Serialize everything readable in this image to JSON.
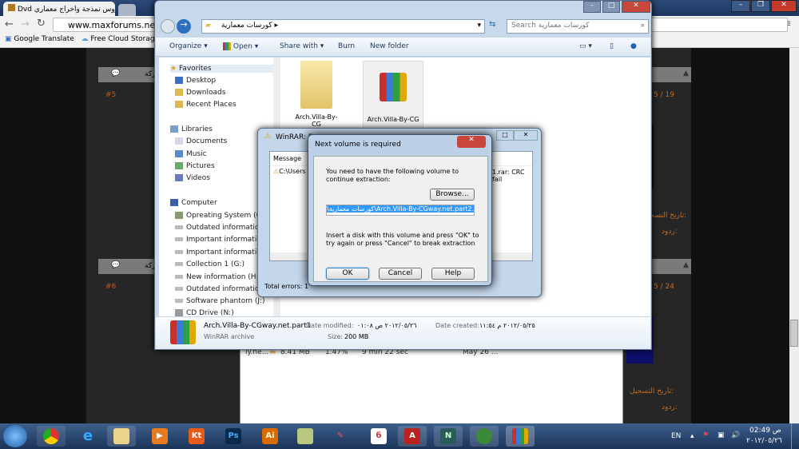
{
  "browser": {
    "tab_title": "Dvd روس نمذجة واخراج معماري",
    "url": "www.maxforums.net/s",
    "bookmarks": [
      "Google Translate",
      "Free Cloud Storage -"
    ]
  },
  "forum": {
    "posts": [
      {
        "num": "#5",
        "date": "5 / 19",
        "label1": "تاريخ التسجيل:",
        "label2": "ردود:",
        "action": "مشاركة"
      },
      {
        "num": "#6",
        "date": "5 / 24",
        "label1": "تاريخ التسجيل:",
        "label2": "ردود:",
        "action": "مشاركة"
      }
    ]
  },
  "explorer": {
    "breadcrumb": "كورسات معمارية",
    "search_placeholder": "Search كورسات معمارية",
    "toolbar": {
      "organize": "Organize",
      "open": "Open",
      "share": "Share with",
      "burn": "Burn",
      "new_folder": "New folder"
    },
    "nav": {
      "favorites": "Favorites",
      "fav_items": [
        "Desktop",
        "Downloads",
        "Recent Places"
      ],
      "libraries": "Libraries",
      "lib_items": [
        "Documents",
        "Music",
        "Pictures",
        "Videos"
      ],
      "computer": "Computer",
      "drives": [
        "Opreating System (C:)",
        "Outdated information",
        "Important information",
        "Important information",
        "Collection 1 (G:)",
        "New information (H:)",
        "Outdated information",
        "Software phantom  (J:)",
        "CD Drive (N:)"
      ]
    },
    "files": [
      "Arch.Villa-By-CG",
      "Arch.Villa-By-CG"
    ],
    "details": {
      "name": "Arch.Villa-By-CGway.net.part1",
      "type": "WinRAR archive",
      "modified_label": "Date modified:",
      "modified": "٢٠١٢/٠٥/٢٦ ص ٠١:٠٨",
      "created_label": "Date created:",
      "created": "٢٠١٢/٠٥/٢٥ م ١١:٥٤",
      "size_label": "Size:",
      "size": "200 MB"
    }
  },
  "winrar_diag": {
    "title": "WinRAR: D",
    "col": "Message",
    "msg_left": "C:\\Users",
    "msg_right": "1.rar: CRC fail",
    "status": "Total errors: 1"
  },
  "dialog": {
    "title": "Next volume is required",
    "text1": "You need to have the following volume to continue extraction:",
    "browse": "Browse...",
    "path": "\\كورسات معمارية\\Arch.Villa-By-CGway.net.part2.rar",
    "text2": "Insert a disk with this volume and press \"OK\" to try again or press \"Cancel\" to break extraction",
    "ok": "OK",
    "cancel": "Cancel",
    "help": "Help"
  },
  "downloads": {
    "row": [
      "ly.ne...",
      "8.41 MB",
      "1.47%",
      "9 min 22 sec",
      "May 26 ..."
    ]
  },
  "taskbar": {
    "apps": [
      "Chrome",
      "Internet Explorer",
      "Windows Explorer",
      "Media Player",
      "KT",
      "Photoshop",
      "Illustrator",
      "Notes",
      "Paint",
      "3D",
      "AutoCAD",
      "3ds Max",
      "Download Manager",
      "WinRAR"
    ],
    "ps": "Ps",
    "ai": "Ai",
    "kt": "Kt",
    "lang": "EN",
    "time": "02:49 ص",
    "date": "٢٠١٢/٠٥/٢٦"
  }
}
